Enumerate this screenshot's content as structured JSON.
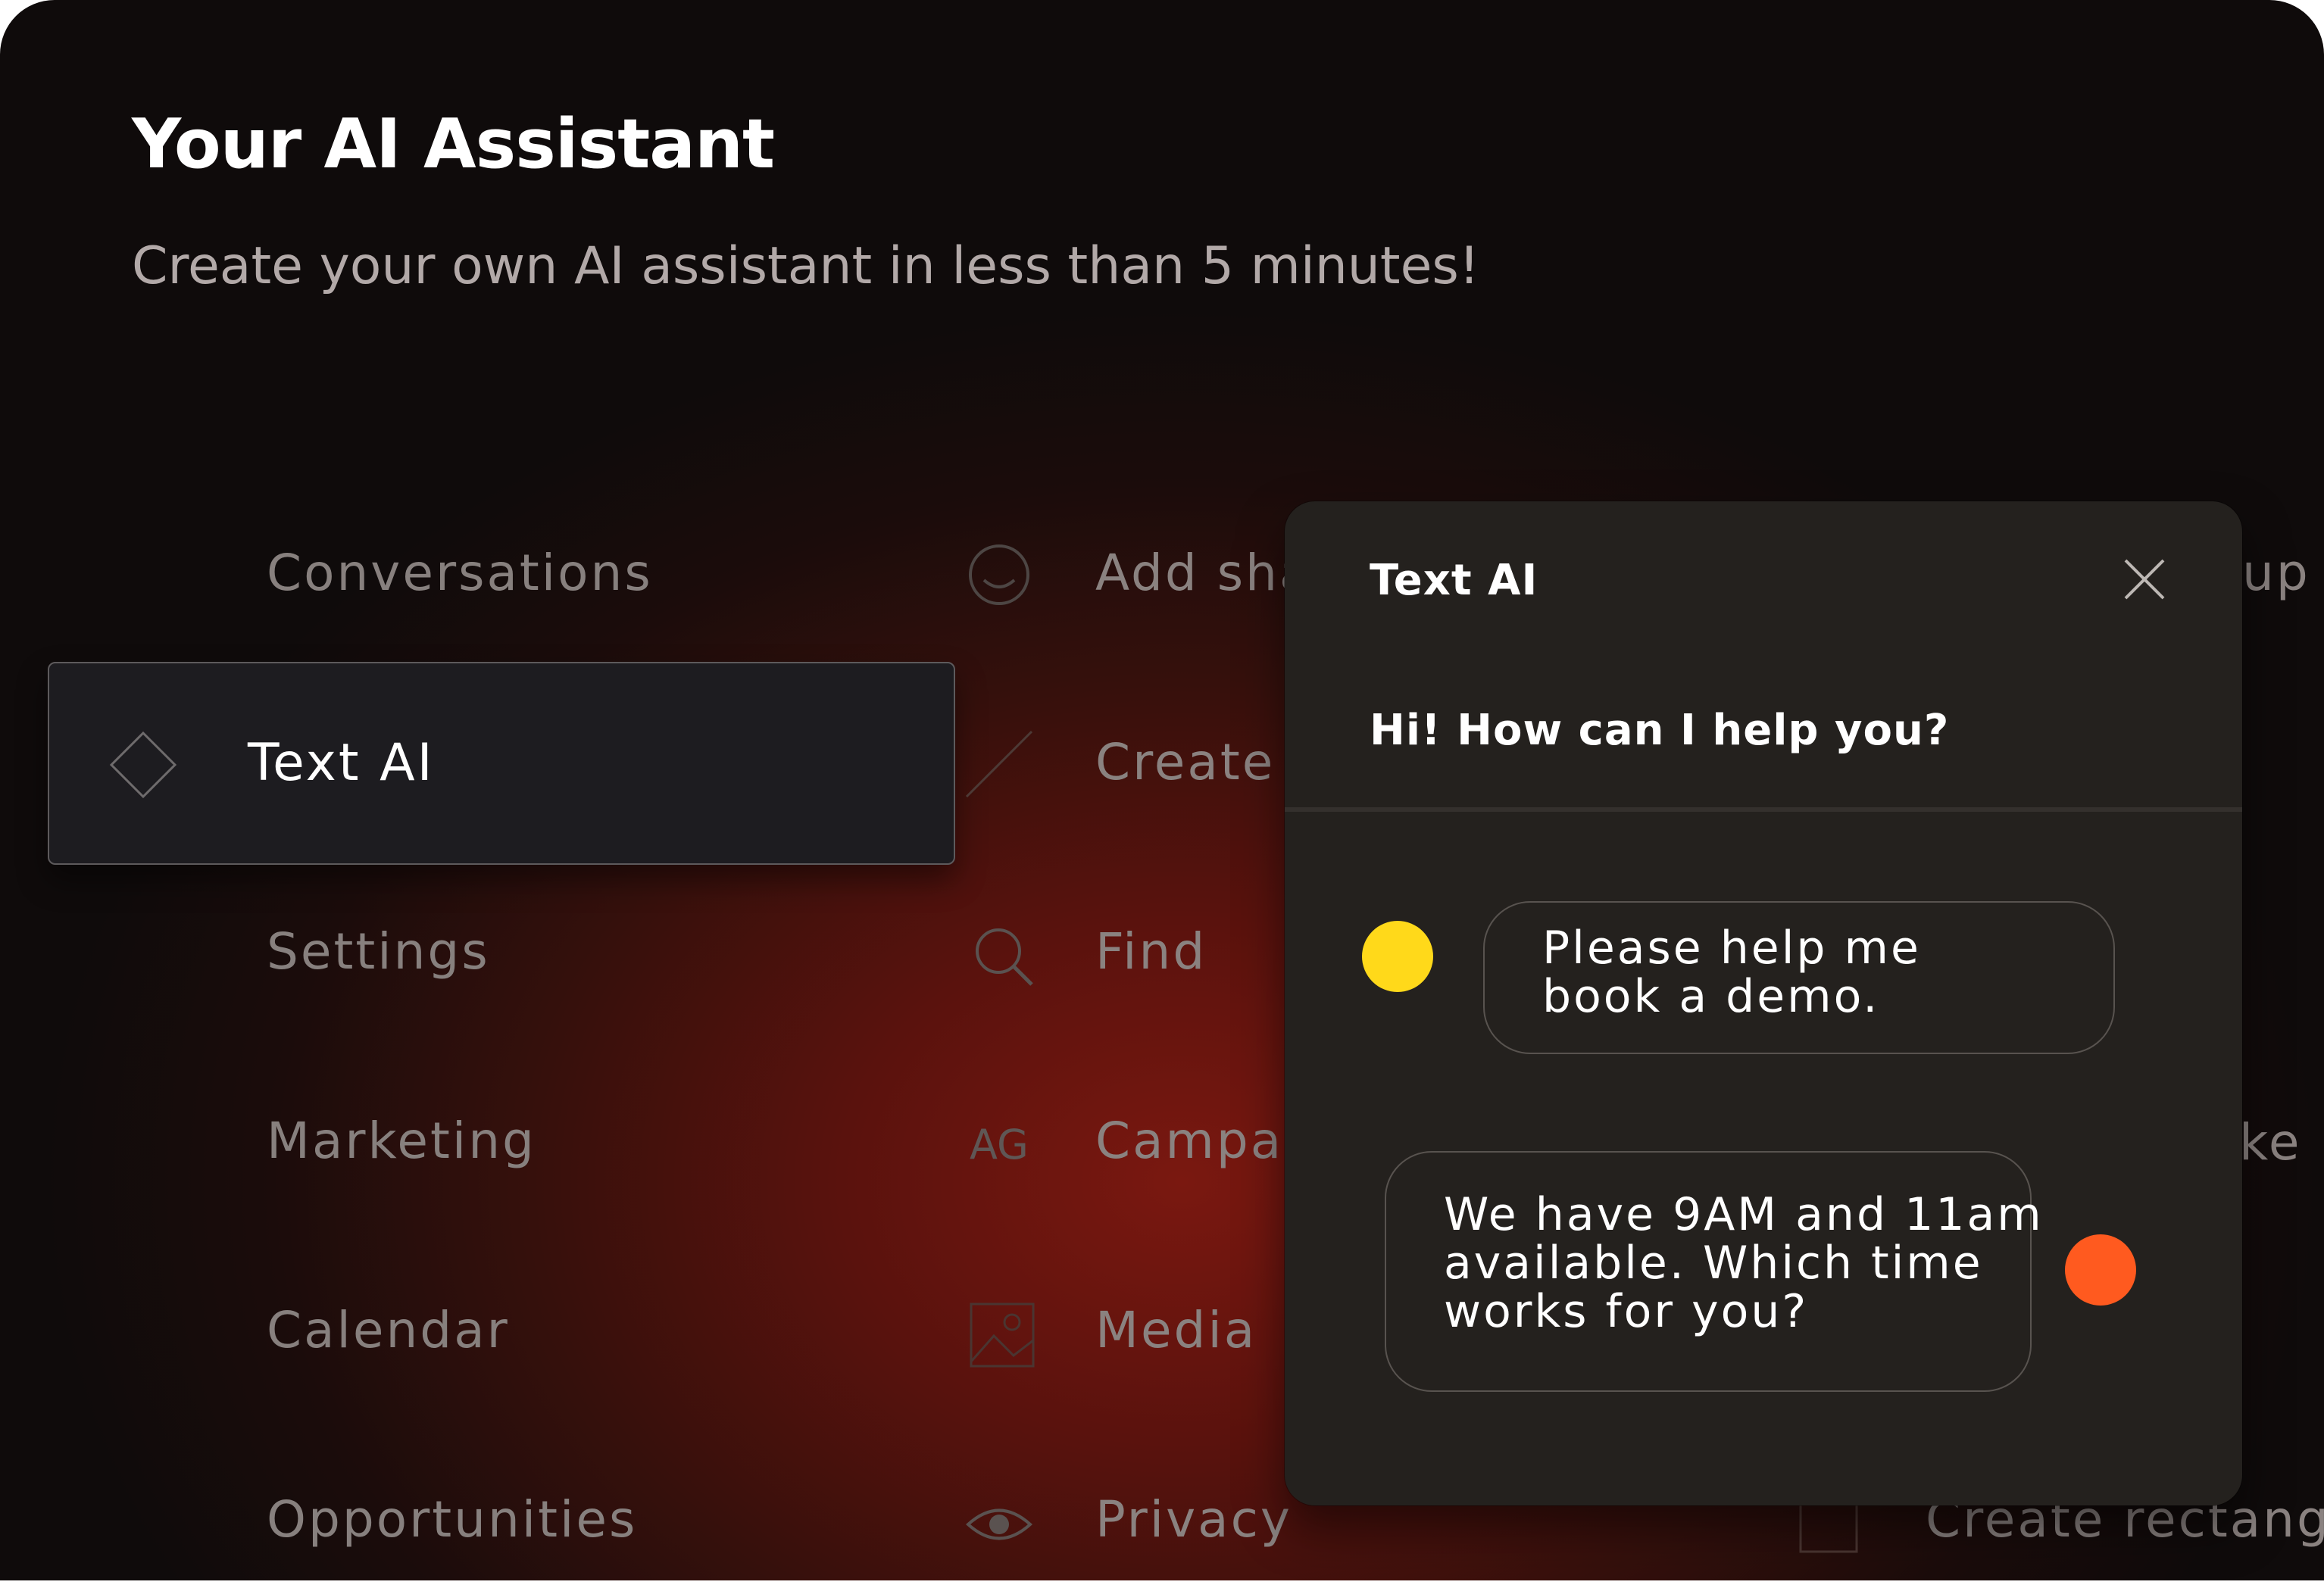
{
  "header": {
    "title": "Your AI Assistant",
    "subtitle": "Create your own AI assistant in less than 5 minutes!"
  },
  "menu": {
    "items": [
      {
        "label": "Conversations"
      },
      {
        "label": "Text AI",
        "selected": true
      },
      {
        "label": "Settings"
      },
      {
        "label": "Marketing"
      },
      {
        "label": "Calendar"
      },
      {
        "label": "Opportunities"
      }
    ]
  },
  "actions": {
    "items": [
      {
        "label": "Add sha",
        "icon": "circle-smile-icon"
      },
      {
        "label": "Create",
        "icon": "slash-line-icon"
      },
      {
        "label": "Find",
        "icon": "search-icon"
      },
      {
        "label": "Campaig",
        "icon": "ag-text-icon",
        "icon_text": "AG"
      },
      {
        "label": "Media",
        "icon": "image-icon"
      },
      {
        "label": "Privacy",
        "icon": "eye-icon"
      }
    ]
  },
  "background_peek": {
    "top_right": "up",
    "mid_right": "ke",
    "bottom_right": "Create rectangl"
  },
  "chat": {
    "title": "Text AI",
    "greeting": "Hi! How can I help you?",
    "messages": [
      {
        "role": "user",
        "lines": [
          "Please help me",
          "book a demo."
        ],
        "avatar_color": "#ffd91a"
      },
      {
        "role": "assistant",
        "lines": [
          "We have 9AM and 11am",
          "available. Which time",
          "works for you?"
        ],
        "avatar_color": "#ff5a1f"
      }
    ]
  },
  "colors": {
    "background_dark": "#0f0b0b",
    "background_red": "#7a1810",
    "panel": "#24211e",
    "card": "#1d1c20",
    "user_avatar": "#ffd91a",
    "bot_avatar": "#ff5a1f"
  }
}
